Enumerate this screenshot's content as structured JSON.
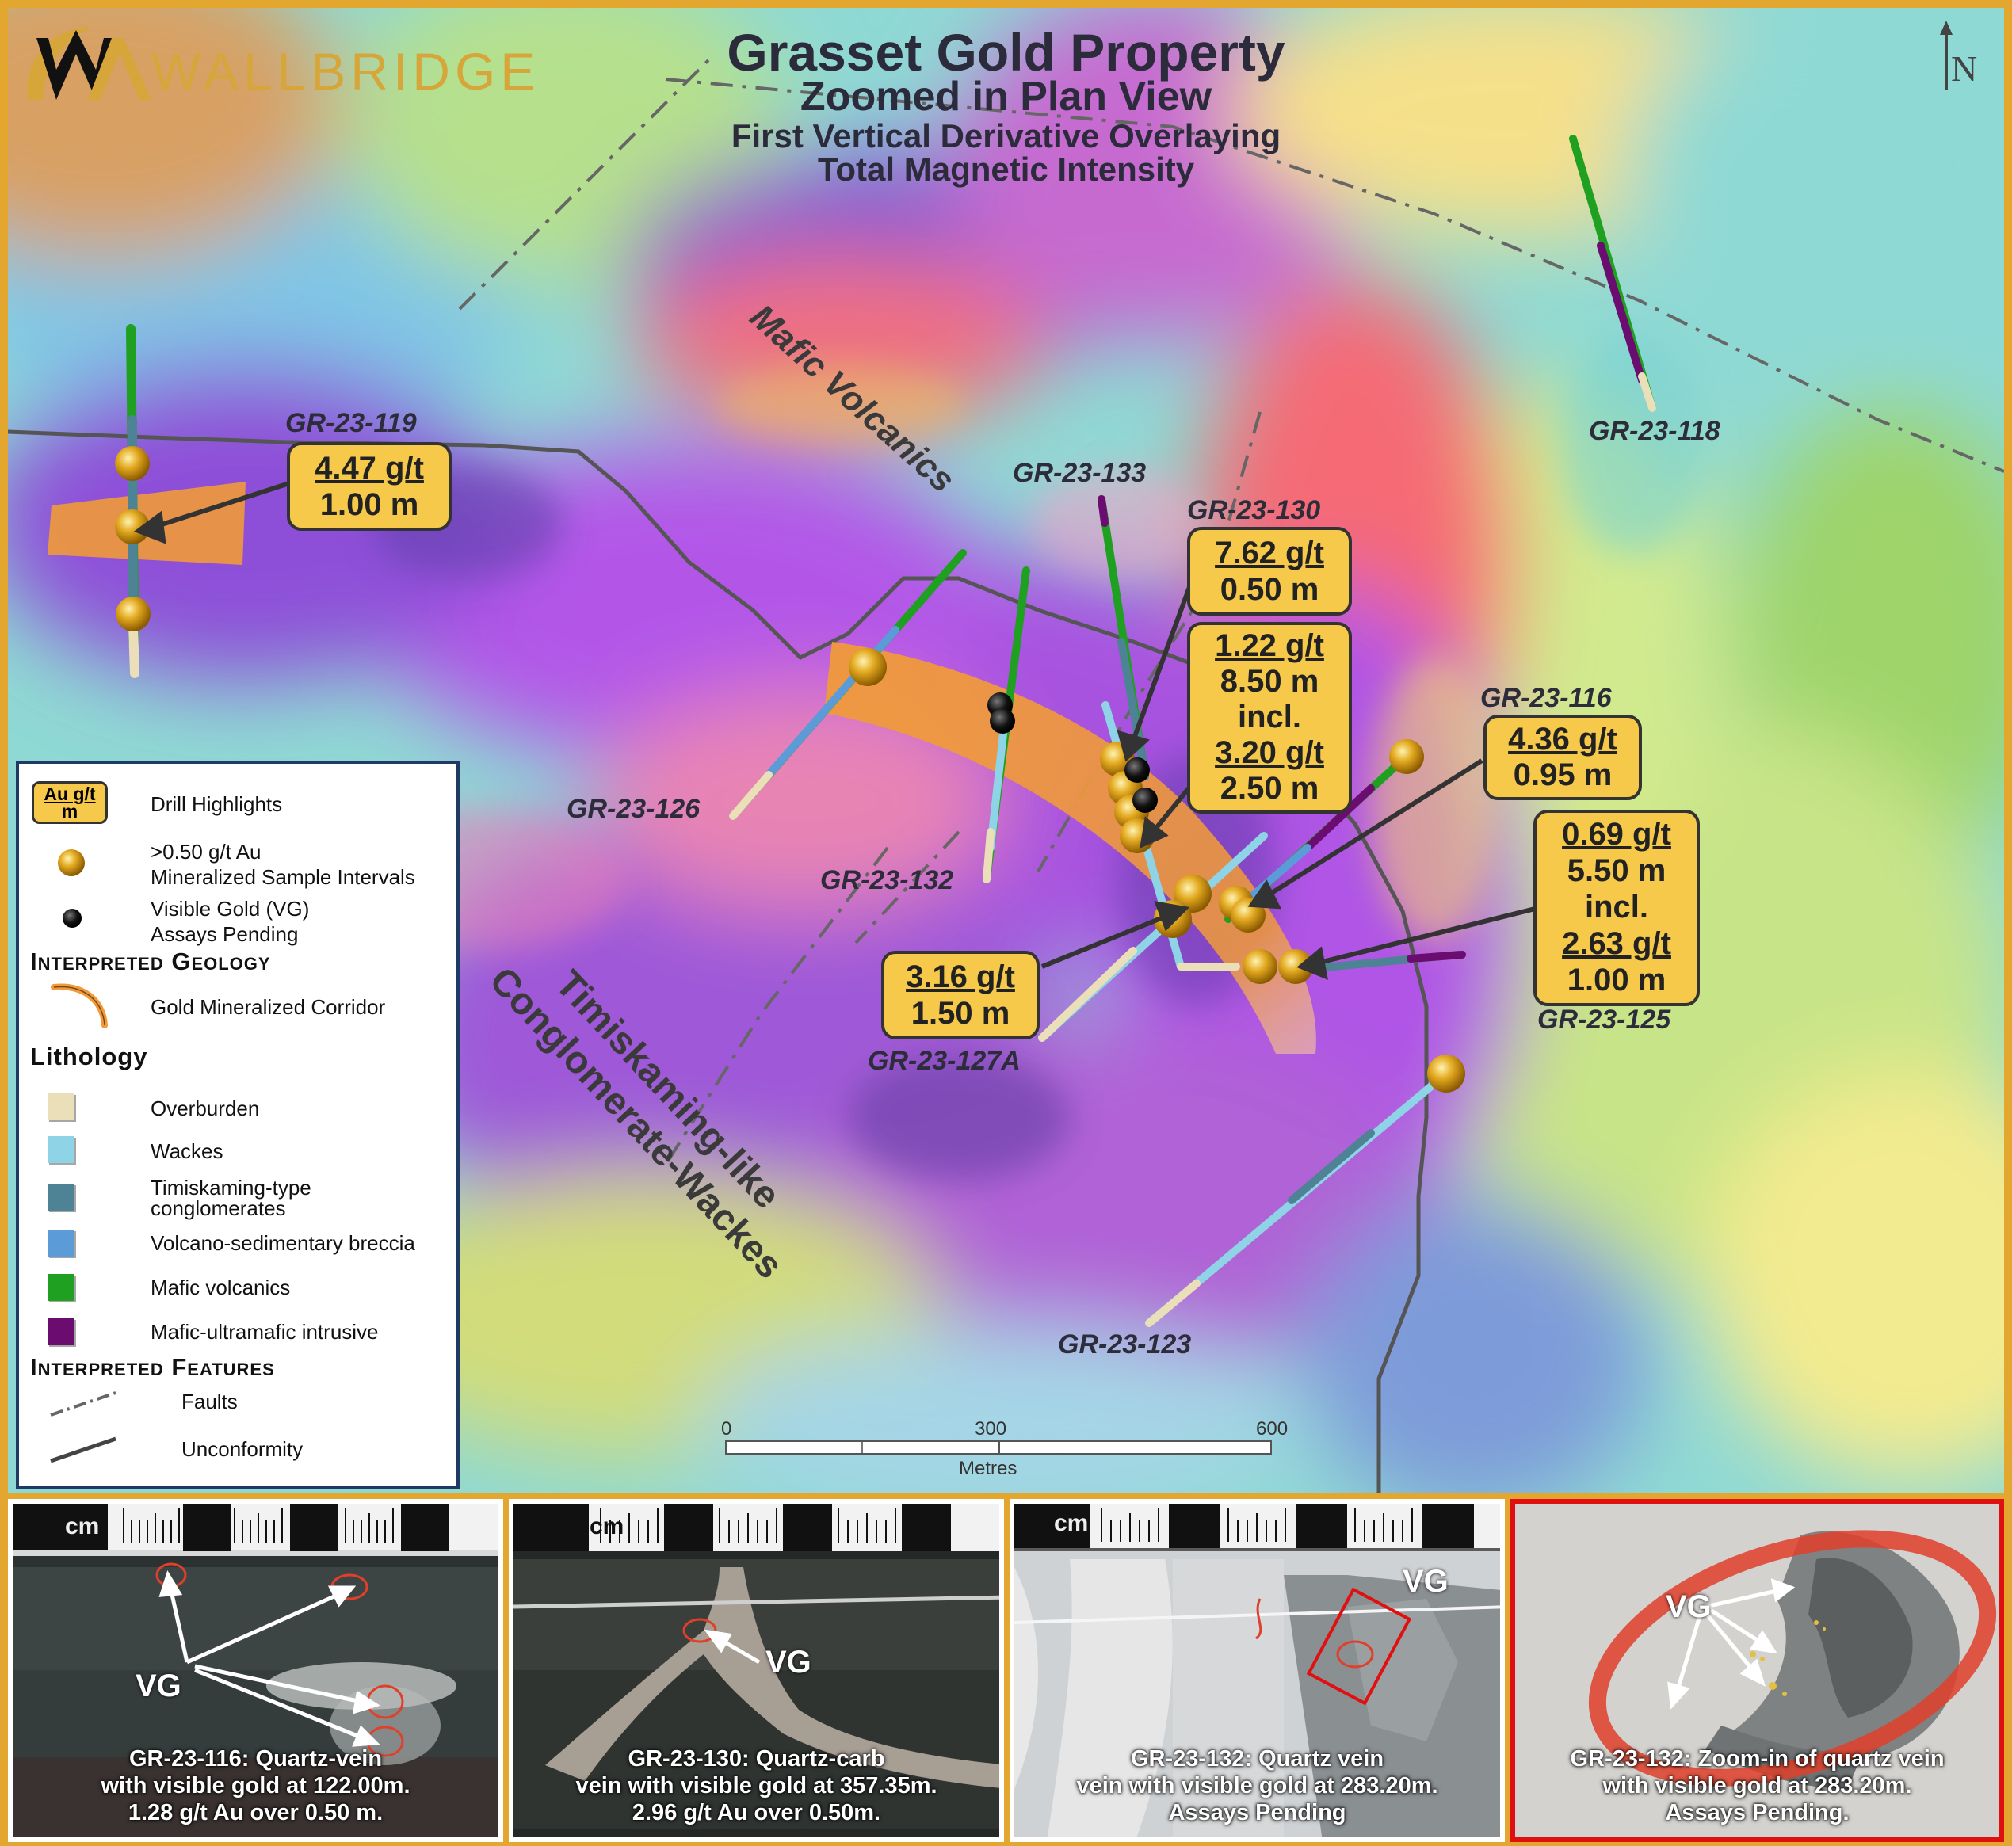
{
  "brand": {
    "name": "WALLBRIDGE"
  },
  "title": {
    "line1": "Grasset Gold Property",
    "line2": "Zoomed in Plan View",
    "line3": "First Vertical Derivative Overlaying",
    "line4": "Total Magnetic Intensity"
  },
  "north_label": "N",
  "region_labels": {
    "mafic": "Mafic Volcanics",
    "timisk_line1": "Timiskaming-like",
    "timisk_line2": "Conglomerate-Wackes"
  },
  "holes": {
    "gr119": "GR-23-119",
    "gr118": "GR-23-118",
    "gr133": "GR-23-133",
    "gr130": "GR-23-130",
    "gr116": "GR-23-116",
    "gr126": "GR-23-126",
    "gr132": "GR-23-132",
    "gr127a": "GR-23-127A",
    "gr125": "GR-23-125",
    "gr123": "GR-23-123"
  },
  "callouts": {
    "c119": [
      "4.47 g/t",
      "1.00 m"
    ],
    "c130": [
      "7.62 g/t",
      "0.50 m"
    ],
    "c133": [
      "1.22 g/t",
      "8.50 m",
      "incl.",
      "3.20 g/t",
      "2.50 m"
    ],
    "c116": [
      "4.36 g/t",
      "0.95 m"
    ],
    "c125": [
      "0.69 g/t",
      "5.50 m",
      "incl.",
      "2.63 g/t",
      "1.00 m"
    ],
    "c127": [
      "3.16 g/t",
      "1.50 m"
    ]
  },
  "scale": {
    "t0": "0",
    "t1": "300",
    "t2": "600",
    "unit": "Metres"
  },
  "legend": {
    "key_top": "Au g/t",
    "key_bot": "m",
    "drill_highlights": "Drill Highlights",
    "min_line1": ">0.50 g/t Au",
    "min_line2": "Mineralized Sample Intervals",
    "vg_line1": "Visible Gold (VG)",
    "vg_line2": "Assays Pending",
    "geology_heading": "Interpreted Geology",
    "corridor": "Gold Mineralized Corridor",
    "lithology_heading": "Lithology",
    "items": [
      {
        "label": "Overburden",
        "color": "#eadfb8"
      },
      {
        "label": "Wackes",
        "color": "#8fd3e6"
      },
      {
        "label": "Timiskaming-type",
        "label2": "conglomerates",
        "color": "#4e8295"
      },
      {
        "label": "Volcano-sedimentary breccia",
        "color": "#5a9bd8"
      },
      {
        "label": "Mafic volcanics",
        "color": "#20a020"
      },
      {
        "label": "Mafic-ultramafic intrusive",
        "color": "#6b0d70"
      }
    ],
    "features_heading": "Interpreted Features",
    "faults": "Faults",
    "unconformity": "Unconformity"
  },
  "photos": [
    {
      "caption": [
        "GR-23-116: Quartz-vein",
        "with visible gold at 122.00m.",
        "1.28 g/t Au over 0.50 m."
      ],
      "vg": "VG",
      "cm": "cm"
    },
    {
      "caption": [
        "GR-23-130: Quartz-carb",
        "vein with visible gold at 357.35m.",
        "2.96 g/t Au over 0.50m."
      ],
      "vg": "VG",
      "cm": "cm"
    },
    {
      "caption": [
        "GR-23-132: Quartz vein",
        "vein with visible gold at 283.20m.",
        "Assays Pending"
      ],
      "vg": "VG",
      "cm": "cm"
    },
    {
      "caption": [
        "GR-23-132: Zoom-in of quartz vein",
        "with visible gold at 283.20m.",
        "Assays Pending."
      ],
      "vg": "VG"
    }
  ],
  "colors": {
    "frame": "#e3a72f",
    "callout_fill": "#f7c94a",
    "corridor": "#f09a3a",
    "gold_ball": "#e0a820",
    "legend_border": "#1f3b64",
    "zoom_border": "#e01010"
  }
}
